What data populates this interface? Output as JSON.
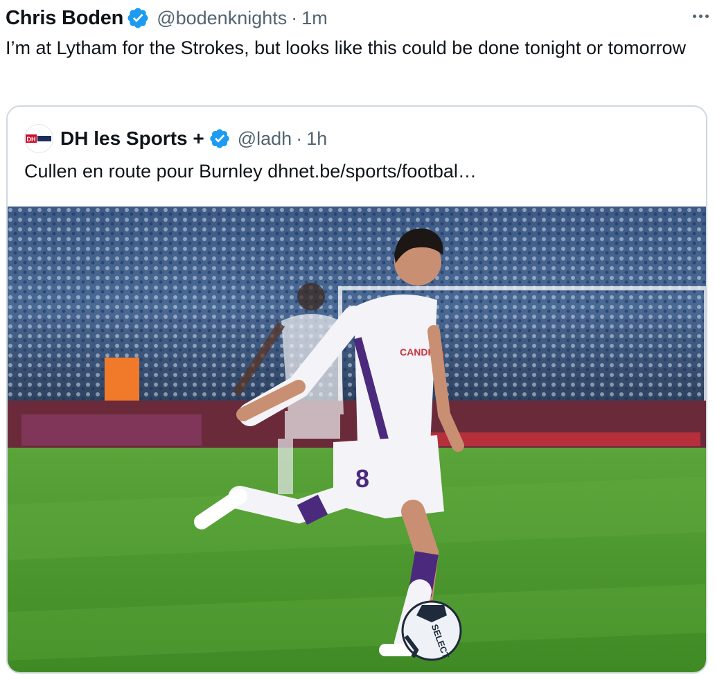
{
  "tweet": {
    "author_name": "Chris Boden",
    "handle": "@bodenknights",
    "separator": "·",
    "time": "1m",
    "text": "I’m at Lytham for the Strokes, but looks like this could be done tonight or tomorrow"
  },
  "quoted_tweet": {
    "author_name": "DH les Sports +",
    "handle": "@ladh",
    "separator": "·",
    "time": "1h",
    "text": "Cullen en route pour Burnley dhnet.be/sports/footbal…",
    "avatar_text": "DH",
    "media": {
      "shirt_text": "CANDRIA",
      "shirt_number": "8",
      "ball_text": "SELECT"
    }
  },
  "icons": {
    "verified": "verified-badge-icon",
    "more": "more-options-icon"
  },
  "colors": {
    "verified_blue": "#1d9bf0",
    "secondary_text": "#536471",
    "border": "#cfd9de",
    "pitch_green": "#4e9a2f",
    "kit_purple": "#4b2a7e"
  }
}
